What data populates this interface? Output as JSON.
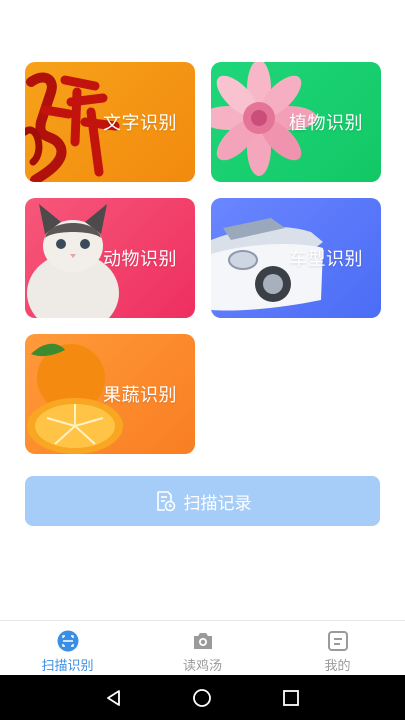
{
  "cards": {
    "text": {
      "label": "文字识别",
      "color": "#f28a0e"
    },
    "plant": {
      "label": "植物识别",
      "color": "#12c865"
    },
    "animal": {
      "label": "动物识别",
      "color": "#ee2f60"
    },
    "car": {
      "label": "车型识别",
      "color": "#4b6cf5"
    },
    "fruit": {
      "label": "果蔬识别",
      "color": "#f97e22"
    }
  },
  "history_button": {
    "label": "扫描记录",
    "icon": "document-clock-icon",
    "color": "#a6cdf8"
  },
  "tabbar": {
    "active_color": "#3a8ee6",
    "inactive_color": "#9a9a9a",
    "tabs": [
      {
        "label": "扫描识别",
        "icon": "scan-icon",
        "active": true
      },
      {
        "label": "读鸡汤",
        "icon": "camera-icon",
        "active": false
      },
      {
        "label": "我的",
        "icon": "profile-card-icon",
        "active": false
      }
    ]
  },
  "system_nav": {
    "back": "back-triangle-icon",
    "home": "home-circle-icon",
    "recents": "recents-square-icon"
  }
}
